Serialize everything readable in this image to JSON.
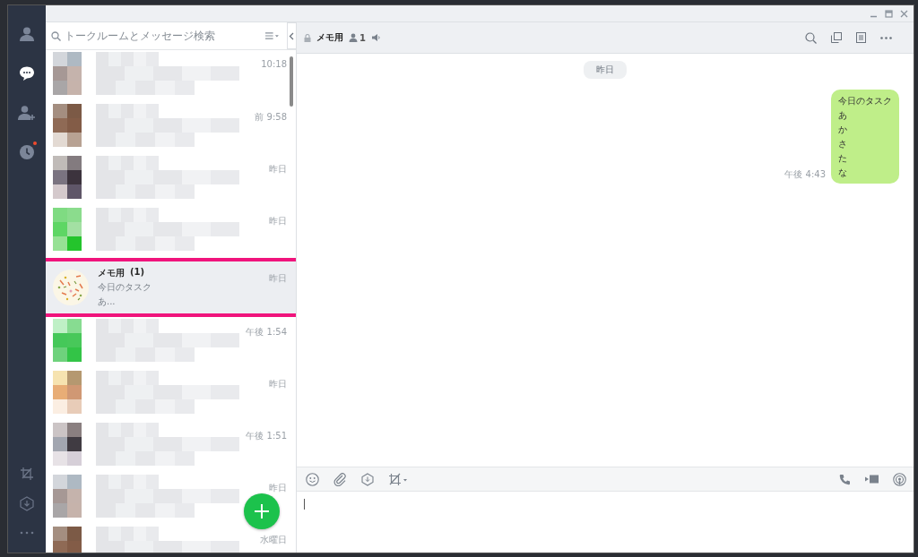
{
  "nav": {
    "items": [
      {
        "kind": "friends",
        "selected": false,
        "notification": false
      },
      {
        "kind": "chats",
        "selected": true,
        "notification": false
      },
      {
        "kind": "add-friend",
        "selected": false,
        "notification": false
      },
      {
        "kind": "timeline",
        "selected": false,
        "notification": true
      }
    ],
    "bottom": [
      {
        "kind": "crop"
      },
      {
        "kind": "keep"
      },
      {
        "kind": "more"
      }
    ]
  },
  "search": {
    "placeholder": "トークルームとメッセージ検索"
  },
  "chats": [
    {
      "kind": "blurred",
      "time": "10:18",
      "selected": false
    },
    {
      "kind": "blurred",
      "time": "前 9:58",
      "selected": false
    },
    {
      "kind": "blurred",
      "time": "昨日",
      "selected": false
    },
    {
      "kind": "blurred",
      "time": "昨日",
      "selected": false
    },
    {
      "kind": "chat",
      "name": "メモ用",
      "count": "(1)",
      "preview": [
        "今日のタスク",
        "あ..."
      ],
      "time": "昨日",
      "selected": true,
      "highlighted": true
    },
    {
      "kind": "blurred",
      "time": "午後 1:54",
      "selected": false
    },
    {
      "kind": "blurred",
      "time": "昨日",
      "selected": false
    },
    {
      "kind": "blurred",
      "time": "午後 1:51",
      "selected": false
    },
    {
      "kind": "blurred",
      "time": "昨日",
      "selected": false
    },
    {
      "kind": "blurred",
      "time": "水曜日",
      "selected": false
    }
  ],
  "chat": {
    "title": "メモ用",
    "members": "1",
    "date": "昨日",
    "messages": [
      {
        "lines": [
          "今日のタスク",
          "あ",
          "か",
          "さ",
          "た",
          "な"
        ],
        "time": "午後 4:43"
      }
    ]
  }
}
